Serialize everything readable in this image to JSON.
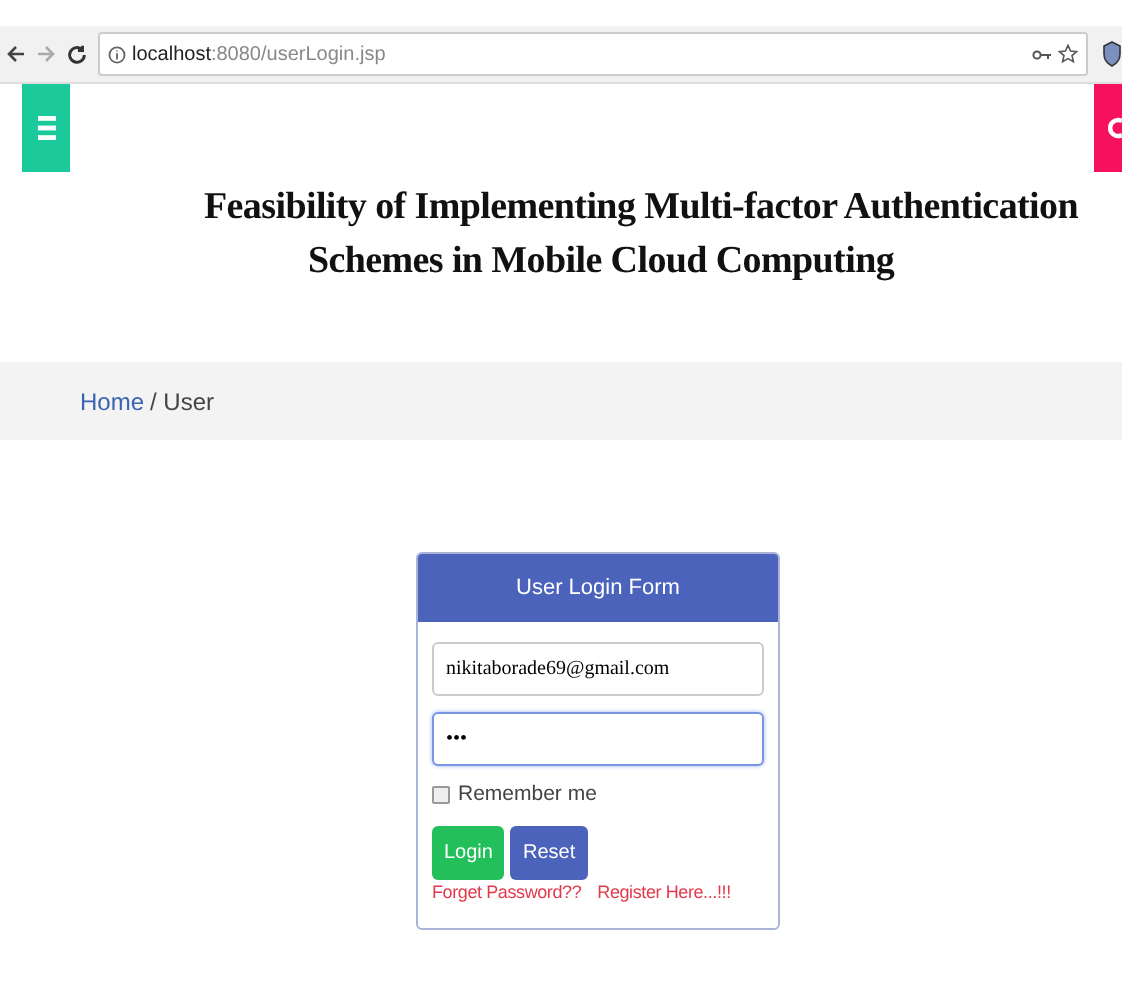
{
  "browser": {
    "url_host": "localhost",
    "url_path": ":8080/userLogin.jsp"
  },
  "title_lines": [
    "Feasibility of Implementing Multi-factor Authentication",
    "Schemes in Mobile Cloud Computing"
  ],
  "breadcrumb": {
    "home": "Home",
    "current": "/ User"
  },
  "form": {
    "header": "User Login Form",
    "email": {
      "value": "nikitaborade69@gmail.com",
      "focused": false
    },
    "password": {
      "value": "•••",
      "focused": true
    },
    "remember": {
      "label": "Remember me",
      "checked": false
    },
    "buttons": [
      {
        "label": "Login",
        "kind": "primary"
      },
      {
        "label": "Reset",
        "kind": "secondary"
      }
    ],
    "links": [
      "Forget Password??",
      "Register Here...!!!"
    ]
  }
}
